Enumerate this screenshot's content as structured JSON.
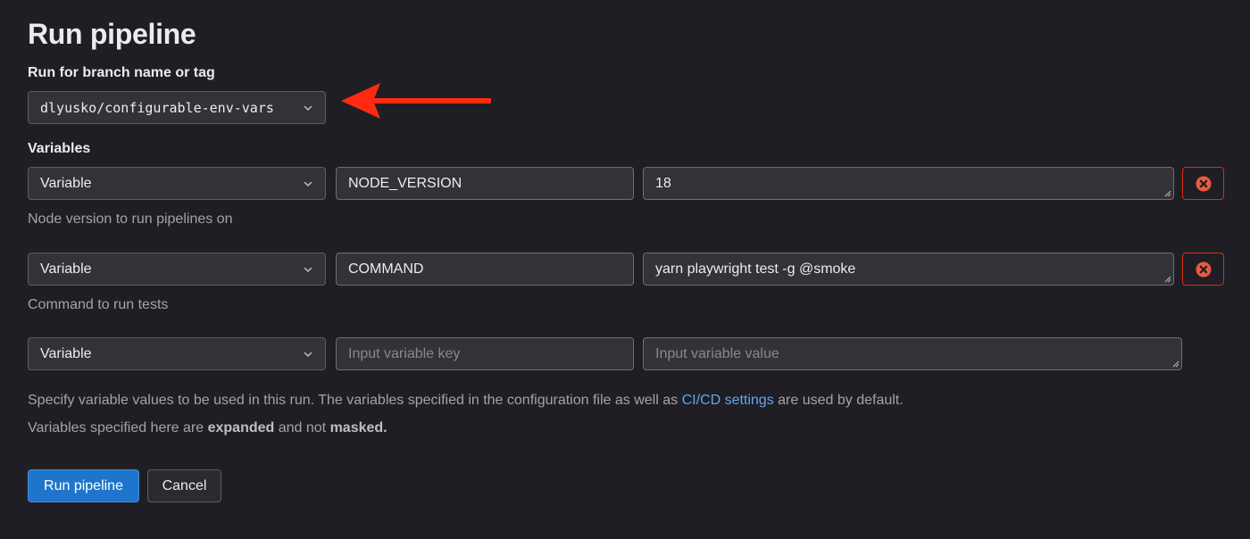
{
  "title": "Run pipeline",
  "branch": {
    "label": "Run for branch name or tag",
    "value": "dlyusko/configurable-env-vars"
  },
  "variables": {
    "label": "Variables",
    "rows": [
      {
        "type": "Variable",
        "key": "NODE_VERSION",
        "value": "18",
        "description": "Node version to run pipelines on"
      },
      {
        "type": "Variable",
        "key": "COMMAND",
        "value": "yarn playwright test -g @smoke",
        "description": "Command to run tests"
      },
      {
        "type": "Variable",
        "key_placeholder": "Input variable key",
        "value_placeholder": "Input variable value"
      }
    ]
  },
  "info": {
    "line1_before": "Specify variable values to be used in this run. The variables specified in the configuration file as well as ",
    "line1_link": "CI/CD settings",
    "line1_after": " are used by default.",
    "line2_before": "Variables specified here are ",
    "line2_bold1": "expanded",
    "line2_mid": " and not ",
    "line2_bold2": "masked."
  },
  "buttons": {
    "run": "Run pipeline",
    "cancel": "Cancel"
  },
  "colors": {
    "background": "#1f1e24",
    "primary": "#1f75cb",
    "danger": "#dd2b0e",
    "link": "#63a6e9",
    "annotation_arrow": "#ff2a12"
  },
  "icons": {
    "select": "chevron-down-icon",
    "remove": "remove-circle-icon",
    "annotation": "arrow-left-icon"
  }
}
